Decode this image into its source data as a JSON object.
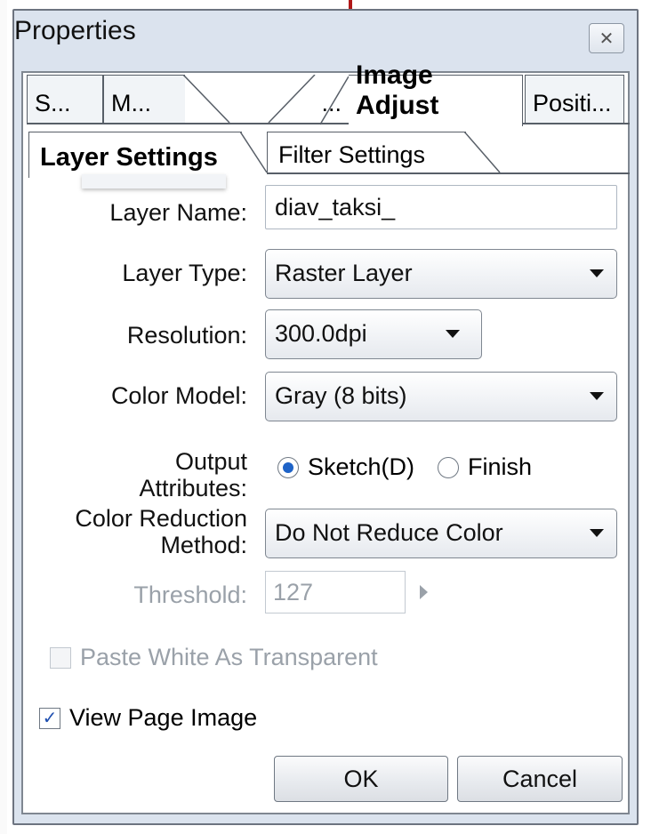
{
  "window": {
    "title": "Properties",
    "close_icon": "close-icon"
  },
  "tabs_top": [
    {
      "label": "S..."
    },
    {
      "label": "M..."
    },
    {
      "label": "..."
    },
    {
      "label": "Image Adjust",
      "active": true
    },
    {
      "label": "Positi..."
    }
  ],
  "tabs_sub": [
    {
      "label": "Layer Settings",
      "active": true
    },
    {
      "label": "Filter Settings"
    }
  ],
  "form": {
    "layer_name": {
      "label": "Layer Name:",
      "value": "diav_taksi_"
    },
    "layer_type": {
      "label": "Layer Type:",
      "value": "Raster Layer"
    },
    "resolution": {
      "label": "Resolution:",
      "value": "300.0dpi"
    },
    "color_model": {
      "label": "Color Model:",
      "value": "Gray (8 bits)"
    },
    "output_attributes": {
      "label_line1": "Output",
      "label_line2": "Attributes:",
      "options": [
        {
          "label": "Sketch(D)",
          "selected": true
        },
        {
          "label": "Finish",
          "selected": false
        }
      ]
    },
    "color_reduction": {
      "label_line1": "Color Reduction",
      "label_line2": "Method:",
      "value": "Do Not Reduce Color"
    },
    "threshold": {
      "label": "Threshold:",
      "value": "127"
    },
    "paste_white": {
      "label": "Paste White As Transparent",
      "checked": false,
      "disabled": true
    },
    "view_page_image": {
      "label": "View Page Image",
      "checked": true
    }
  },
  "buttons": {
    "ok": "OK",
    "cancel": "Cancel"
  },
  "colors": {
    "window_frame": "#dbe3ee",
    "radio_selected": "#1e63c7",
    "disabled_text": "#9aa1a9"
  }
}
